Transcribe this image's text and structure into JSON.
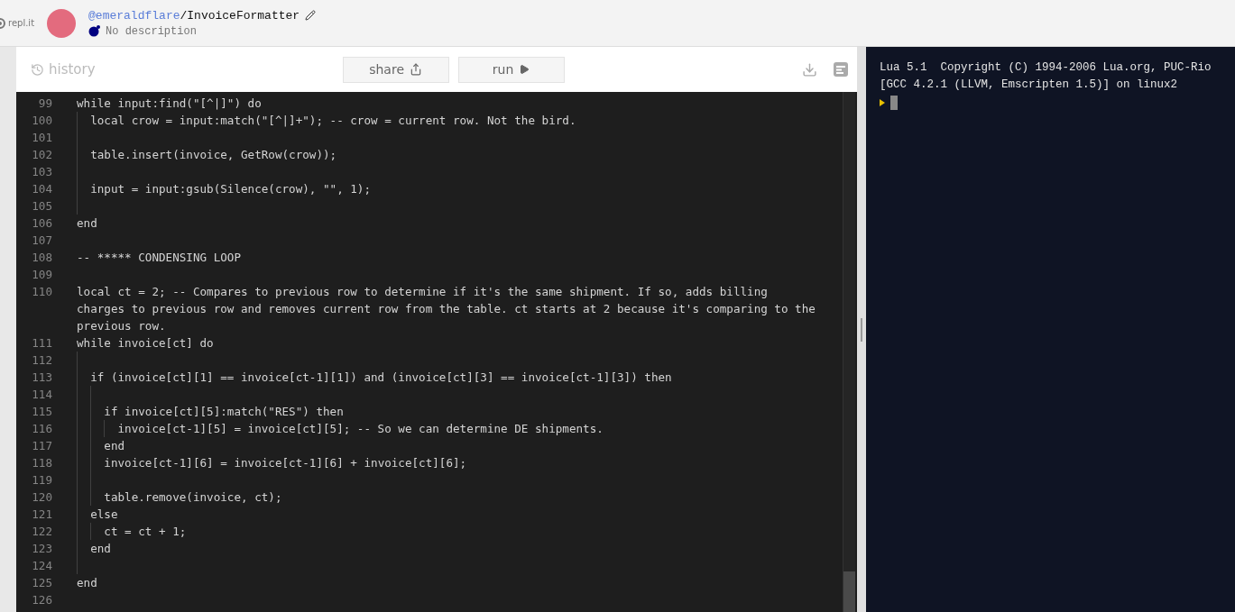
{
  "header": {
    "logo_text": "repl.it",
    "owner": "@emeraldflare",
    "separator": "/",
    "repl_name": "InvoiceFormatter",
    "description": "No description"
  },
  "toolbar": {
    "history": "history",
    "share": "share",
    "run": "run"
  },
  "editor": {
    "lines": [
      {
        "number": "99",
        "text": "while input:find(\"[^|]\") do"
      },
      {
        "number": "100",
        "text": "  local crow = input:match(\"[^|]+\"); -- crow = current row. Not the bird."
      },
      {
        "number": "101"
      },
      {
        "number": "102",
        "text": "  table.insert(invoice, GetRow(crow));"
      },
      {
        "number": "103"
      },
      {
        "number": "104",
        "text": "  input = input:gsub(Silence(crow), \"\", 1);"
      },
      {
        "number": "105"
      },
      {
        "number": "106",
        "text": "end"
      },
      {
        "number": "107"
      },
      {
        "number": "108",
        "text": "-- ***** CONDENSING LOOP"
      },
      {
        "number": "109"
      },
      {
        "number": "110",
        "text": "local ct = 2; -- Compares to previous row to determine if it's the same shipment. If so, adds billing charges to previous row and removes current row from the table. ct starts at 2 because it's comparing to the previous row."
      },
      {
        "number": "111",
        "text": "while invoice[ct] do"
      },
      {
        "number": "112"
      },
      {
        "number": "113",
        "text": "  if (invoice[ct][1] == invoice[ct-1][1]) and (invoice[ct][3] == invoice[ct-1][3]) then"
      },
      {
        "number": "114"
      },
      {
        "number": "115",
        "text": "    if invoice[ct][5]:match(\"RES\") then"
      },
      {
        "number": "116",
        "text": "      invoice[ct-1][5] = invoice[ct][5]; -- So we can determine DE shipments."
      },
      {
        "number": "117",
        "text": "    end"
      },
      {
        "number": "118",
        "text": "    invoice[ct-1][6] = invoice[ct-1][6] + invoice[ct][6];"
      },
      {
        "number": "119"
      },
      {
        "number": "120",
        "text": "    table.remove(invoice, ct);"
      },
      {
        "number": "121",
        "text": "  else"
      },
      {
        "number": "122",
        "text": "    ct = ct + 1;"
      },
      {
        "number": "123",
        "text": "  end"
      },
      {
        "number": "124"
      },
      {
        "number": "125",
        "text": "end"
      },
      {
        "number": "126"
      }
    ]
  },
  "console": {
    "lines": [
      "Lua 5.1  Copyright (C) 1994-2006 Lua.org, PUC-Rio",
      "[GCC 4.2.1 (LLVM, Emscripten 1.5)] on linux2"
    ]
  }
}
